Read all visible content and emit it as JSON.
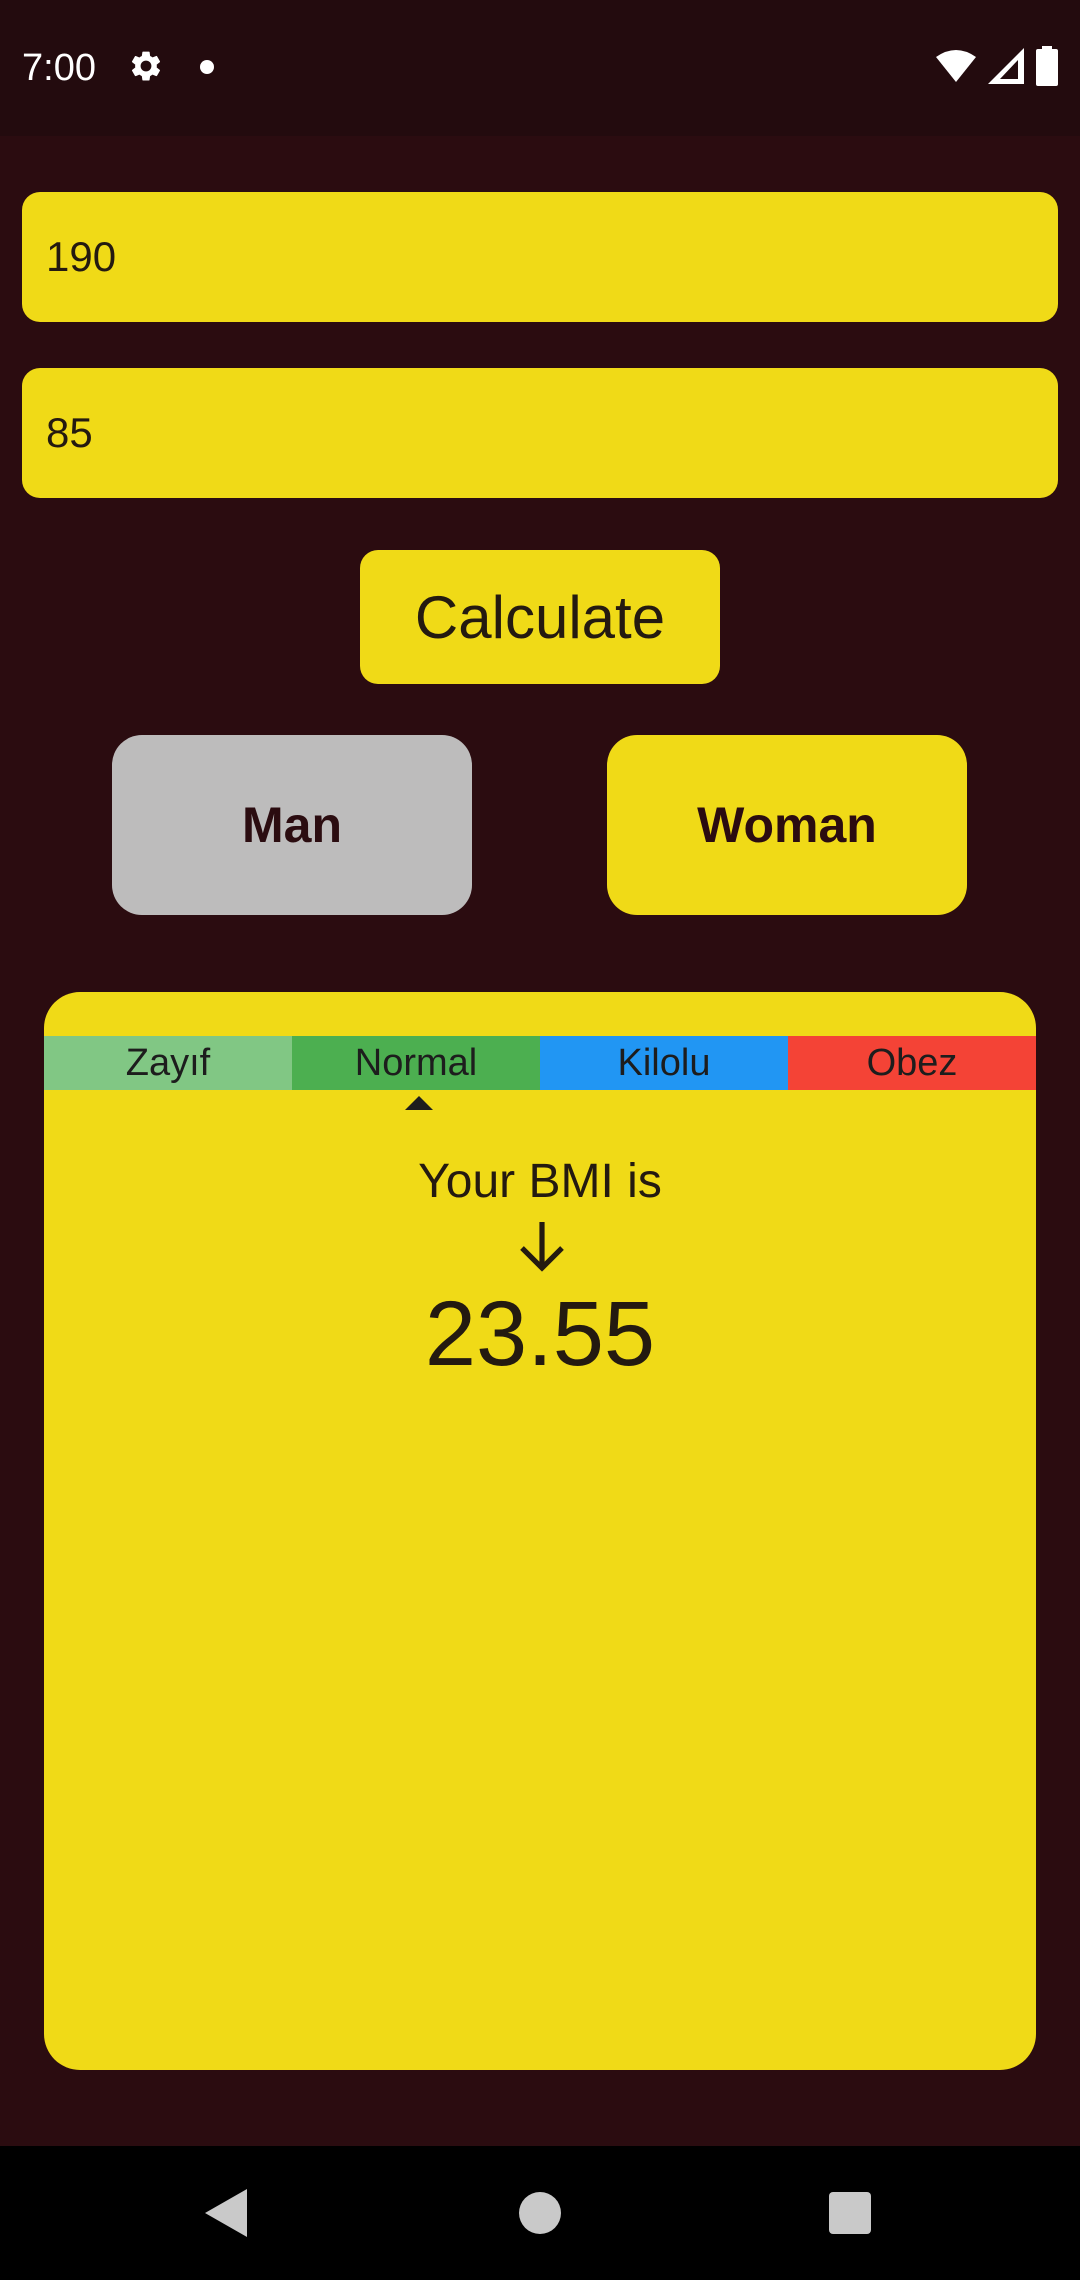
{
  "status_bar": {
    "time": "7:00",
    "icons": [
      "gear-icon",
      "notification-dot-icon",
      "wifi-icon",
      "signal-icon",
      "battery-icon"
    ]
  },
  "form": {
    "height_value": "190",
    "weight_value": "85"
  },
  "buttons": {
    "calculate": "Calculate",
    "man": "Man",
    "woman": "Woman"
  },
  "result": {
    "scale": [
      {
        "label": "Zayıf",
        "color": "#81c784"
      },
      {
        "label": "Normal",
        "color": "#4caf50"
      },
      {
        "label": "Kilolu",
        "color": "#2196f3"
      },
      {
        "label": "Obez",
        "color": "#f44336"
      }
    ],
    "selected_category": "Normal",
    "heading": "Your BMI is",
    "value": "23.55"
  },
  "colors": {
    "background": "#2b0c10",
    "accent_yellow": "#f0da17",
    "selected_gray": "#bdbcbc"
  },
  "nav_bar": {
    "icons": [
      "back-icon",
      "home-icon",
      "recents-icon"
    ]
  }
}
